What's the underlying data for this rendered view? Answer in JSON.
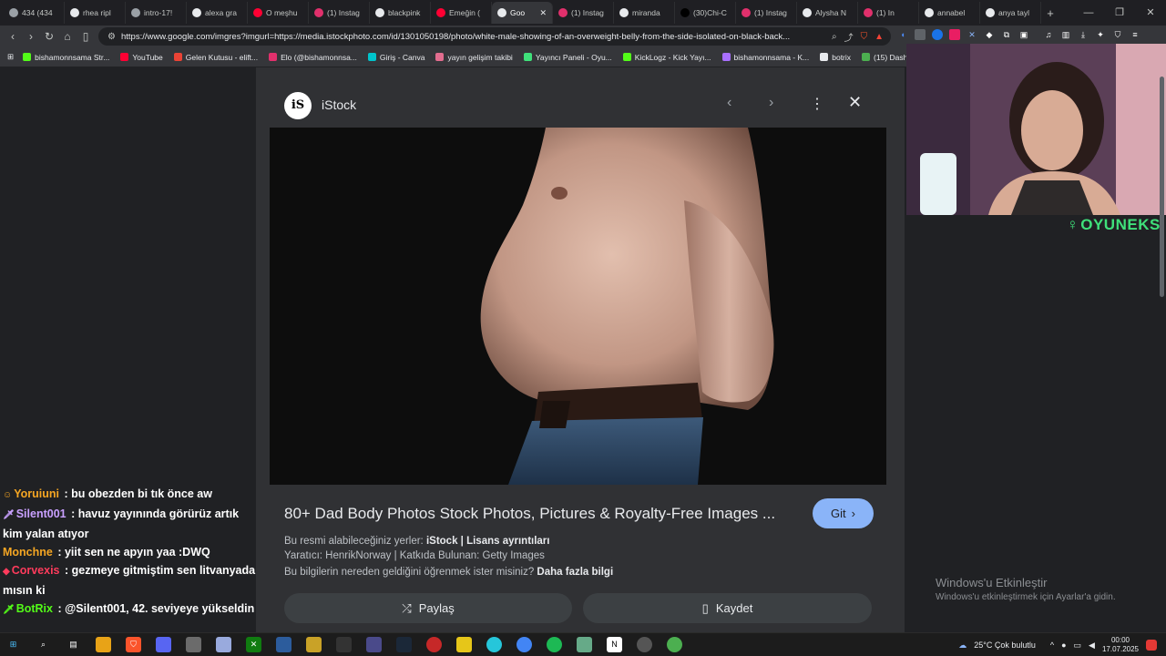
{
  "browser": {
    "tabs": [
      {
        "title": "434 (434",
        "color": "#9aa0a6"
      },
      {
        "title": "rhea ripl",
        "color": "#e8eaed"
      },
      {
        "title": "intro-17!",
        "color": "#9aa0a6"
      },
      {
        "title": "alexa gra",
        "color": "#e8eaed"
      },
      {
        "title": "O meşhu",
        "color": "#ff0033"
      },
      {
        "title": "(1) Instag",
        "color": "#e1306c"
      },
      {
        "title": "blackpink",
        "color": "#e8eaed"
      },
      {
        "title": "Emeğin (",
        "color": "#ff0033"
      },
      {
        "title": "Goo",
        "color": "#e8eaed",
        "active": true
      },
      {
        "title": "(1) Instag",
        "color": "#e1306c"
      },
      {
        "title": "miranda",
        "color": "#e8eaed"
      },
      {
        "title": "(30)Chi-C",
        "color": "#000000"
      },
      {
        "title": "(1) Instag",
        "color": "#e1306c"
      },
      {
        "title": "Alysha N",
        "color": "#e8eaed"
      },
      {
        "title": "(1) In",
        "color": "#e1306c"
      },
      {
        "title": "annabel",
        "color": "#e8eaed"
      },
      {
        "title": "anya tayl",
        "color": "#e8eaed"
      }
    ],
    "url": "https://www.google.com/imgres?imgurl=https://media.istockphoto.com/id/1301050198/photo/white-male-showing-of-an-overweight-belly-from-the-side-isolated-on-black-back...",
    "bookmarks": [
      {
        "label": "bishamonnsama Str...",
        "color": "#53fc18"
      },
      {
        "label": "YouTube",
        "color": "#ff0033"
      },
      {
        "label": "Gelen Kutusu - elift...",
        "color": "#ea4335"
      },
      {
        "label": "Elo (@bishamonnsa...",
        "color": "#e1306c"
      },
      {
        "label": "Giriş - Canva",
        "color": "#00c4cc"
      },
      {
        "label": "yayın gelişim takibi",
        "color": "#e26d8f"
      },
      {
        "label": "Yayıncı Paneli - Oyu...",
        "color": "#3fe07a"
      },
      {
        "label": "KickLogz - Kick Yayı...",
        "color": "#53fc18"
      },
      {
        "label": "bishamonnsama - K...",
        "color": "#a970ff"
      },
      {
        "label": "botrix",
        "color": "#e8eaed"
      },
      {
        "label": "(15) Dashboard",
        "color": "#4caf50"
      }
    ]
  },
  "chat": [
    {
      "nick": "Yoruiuni",
      "nick_color": "#f5a623",
      "text": " : bu obezden bi tık önce aw",
      "badge": "☺"
    },
    {
      "nick": "Silent001",
      "nick_color": "#c9a0ff",
      "text": " : havuz yayınında görürüz artık kim yalan atıyor",
      "badge": "🗡"
    },
    {
      "nick": "Monchne",
      "nick_color": "#f5a623",
      "text": " : yiit sen ne apyın yaa :DWQ",
      "badge": ""
    },
    {
      "nick": "Corvexis",
      "nick_color": "#ff3b5c",
      "text": " : gezmeye gitmiştim sen litvanyada mısın ki",
      "badge": "◆"
    },
    {
      "nick": "BotRix",
      "nick_color": "#53fc18",
      "text": " : @Silent001, 42. seviyeye yükseldin",
      "badge": "🗡"
    }
  ],
  "viewer": {
    "source_name": "iStock",
    "source_logo": "iS",
    "title": "80+ Dad Body Photos Stock Photos, Pictures & Royalty-Free Images ...",
    "visit_label": "Git",
    "licence_prefix": "Bu resmi alabileceğiniz yerler: ",
    "licence_source": "iStock",
    "licence_sep": " | ",
    "licence_link": "Lisans ayrıntıları",
    "credit": "Yaratıcı: HenrikNorway | Katkıda Bulunan: Getty Images",
    "learn_text": "Bu bilgilerin nereden geldiğini öğrenmek ister misiniz? ",
    "learn_link": "Daha fazla bilgi",
    "share_label": "Paylaş",
    "save_label": "Kaydet"
  },
  "overlay": {
    "brand": "OYUNEKS"
  },
  "windows": {
    "activate_title": "Windows'u Etkinleştir",
    "activate_sub": "Windows'u etkinleştirmek için Ayarlar'a gidin."
  },
  "taskbar": {
    "weather": "25°C  Çok bulutlu",
    "time": "00:00",
    "date": "17.07.2025"
  }
}
